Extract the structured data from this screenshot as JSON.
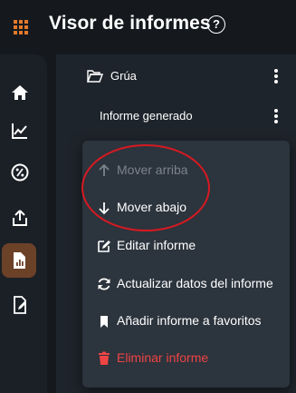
{
  "app": {
    "title": "Visor de informes",
    "help_symbol": "?"
  },
  "colors": {
    "accent": "#e37a2b",
    "danger": "#ef4444",
    "annotation": "#d71921"
  },
  "sidebar": {
    "items": [
      {
        "icon": "home-icon"
      },
      {
        "icon": "line-chart-icon"
      },
      {
        "icon": "percent-icon"
      },
      {
        "icon": "share-icon"
      },
      {
        "icon": "report-icon",
        "active": true
      },
      {
        "icon": "edit-document-icon"
      }
    ]
  },
  "list": {
    "folder": {
      "icon": "folder-open-icon",
      "label": "Grúa"
    },
    "report": {
      "label": "Informe generado"
    }
  },
  "menu": {
    "items": [
      {
        "icon": "arrow-up-icon",
        "label": "Mover arriba",
        "disabled": true
      },
      {
        "icon": "arrow-down-icon",
        "label": "Mover abajo"
      },
      {
        "icon": "edit-icon",
        "label": "Editar informe"
      },
      {
        "icon": "refresh-icon",
        "label": "Actualizar datos del informe"
      },
      {
        "icon": "bookmark-icon",
        "label": "Añadir informe a favoritos"
      },
      {
        "icon": "trash-icon",
        "label": "Eliminar informe",
        "danger": true
      }
    ]
  }
}
